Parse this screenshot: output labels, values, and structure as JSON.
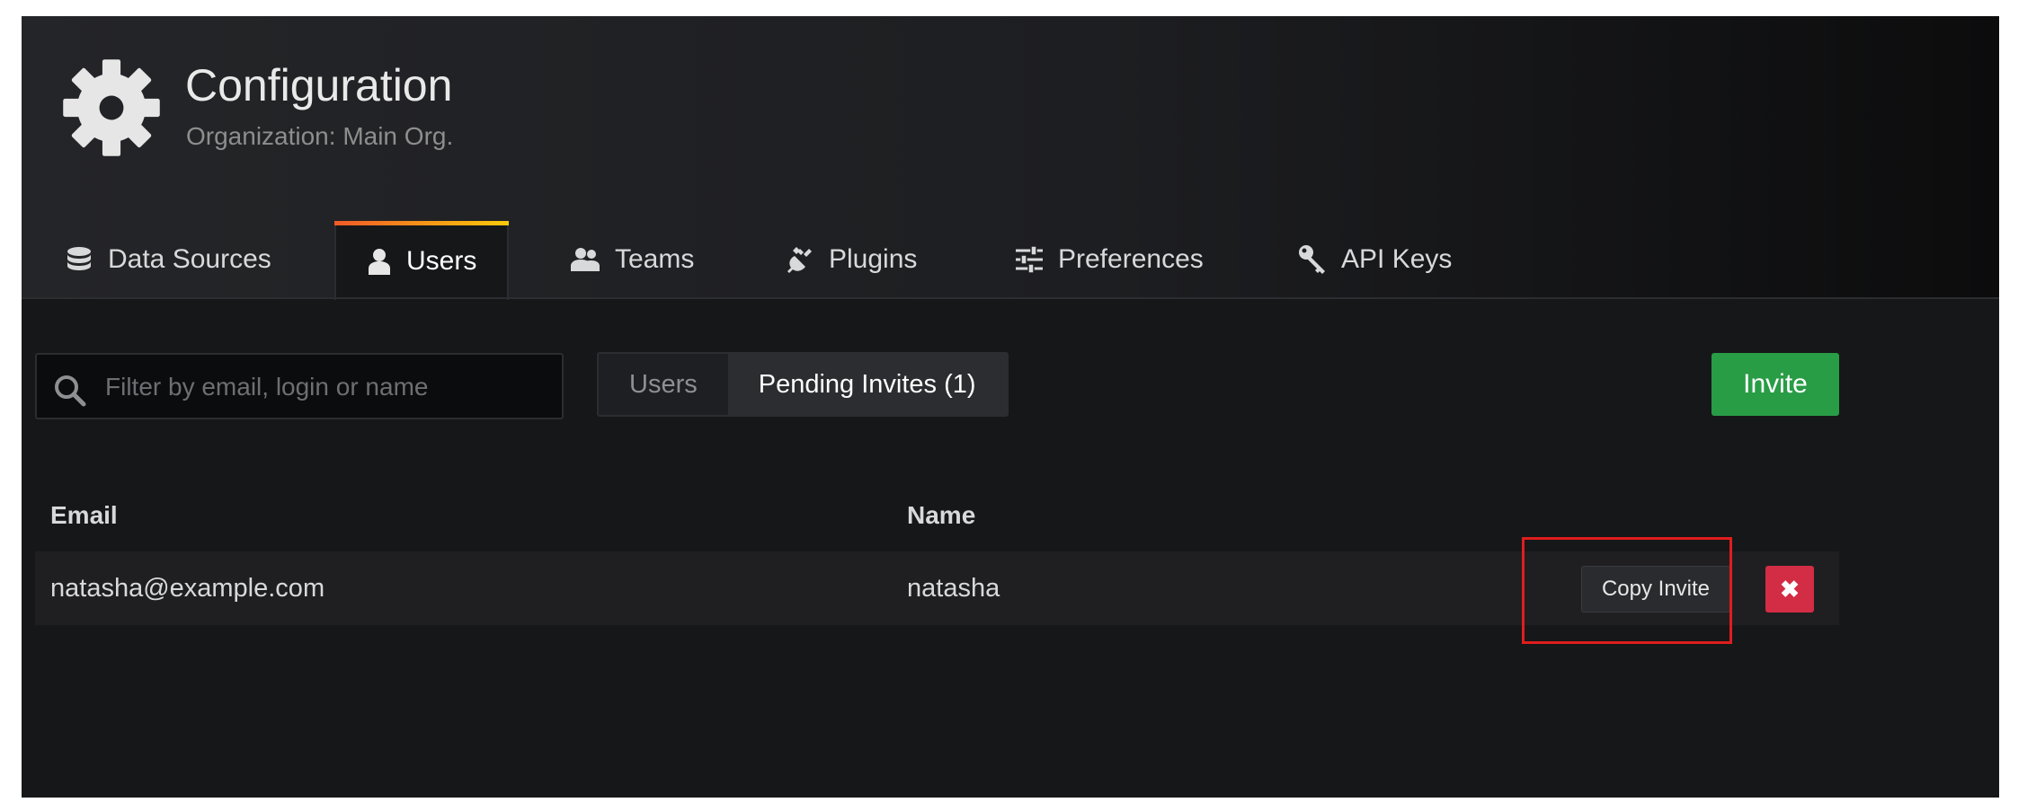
{
  "header": {
    "title": "Configuration",
    "subtitle": "Organization: Main Org."
  },
  "tabs": [
    {
      "label": "Data Sources",
      "icon": "database-icon",
      "active": false
    },
    {
      "label": "Users",
      "icon": "user-icon",
      "active": true
    },
    {
      "label": "Teams",
      "icon": "users-icon",
      "active": false
    },
    {
      "label": "Plugins",
      "icon": "plug-icon",
      "active": false
    },
    {
      "label": "Preferences",
      "icon": "sliders-icon",
      "active": false
    },
    {
      "label": "API Keys",
      "icon": "key-icon",
      "active": false
    }
  ],
  "toolbar": {
    "search_placeholder": "Filter by email, login or name",
    "toggle_users": "Users",
    "toggle_pending": "Pending Invites (1)",
    "invite_label": "Invite"
  },
  "table": {
    "columns": [
      "Email",
      "Name"
    ],
    "rows": [
      {
        "email": "natasha@example.com",
        "name": "natasha",
        "copy_label": "Copy Invite",
        "delete_label": "✖"
      }
    ]
  },
  "colors": {
    "background": "#161719",
    "accent_gradient_start": "#f05a28",
    "accent_gradient_end": "#fbca0a",
    "invite_green": "#299c46",
    "delete_red": "#d32d45",
    "highlight_red": "#e01d1d"
  }
}
